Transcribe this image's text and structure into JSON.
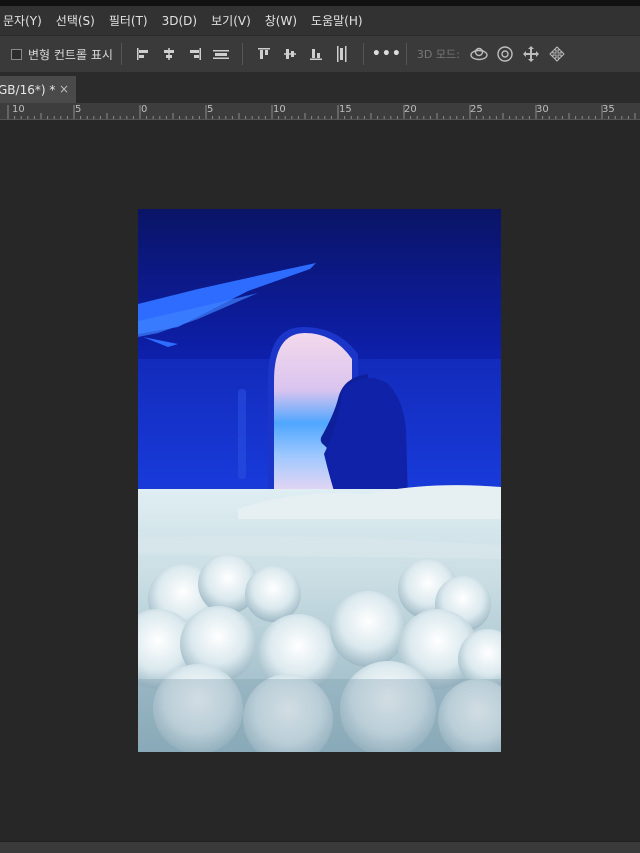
{
  "menu": [
    "문자(Y)",
    "선택(S)",
    "필터(T)",
    "3D(D)",
    "보기(V)",
    "창(W)",
    "도움말(H)"
  ],
  "options": {
    "transform_label": "변형 컨트롤 표시",
    "more_label": "•••",
    "mode_label": "3D 모드:",
    "align_icons": [
      "align-left-edges-icon",
      "align-horizontal-centers-icon",
      "align-right-edges-icon",
      "distribute-horizontal-icon",
      "align-top-edges-icon",
      "align-vertical-centers-icon",
      "align-bottom-edges-icon",
      "distribute-vertical-icon"
    ],
    "mode_icons": [
      "orbit-3d-icon",
      "roll-3d-icon",
      "pan-3d-icon",
      "slide-3d-icon"
    ]
  },
  "tab": {
    "title": "GB/16*) *",
    "close": "×"
  },
  "ruler": {
    "labels": [
      "10",
      "5",
      "0",
      "5",
      "10",
      "15",
      "20",
      "25",
      "30",
      "35"
    ]
  },
  "colors": {
    "ui_dark": "#262626",
    "menubar": "#323232",
    "optionsbar": "#3a3a3a",
    "tab_active": "#4a4a4a",
    "sky_blue": "#1228c8",
    "cloud": "#c8dde4"
  },
  "document": {
    "name": "airplane-window-clouds-artwork"
  }
}
